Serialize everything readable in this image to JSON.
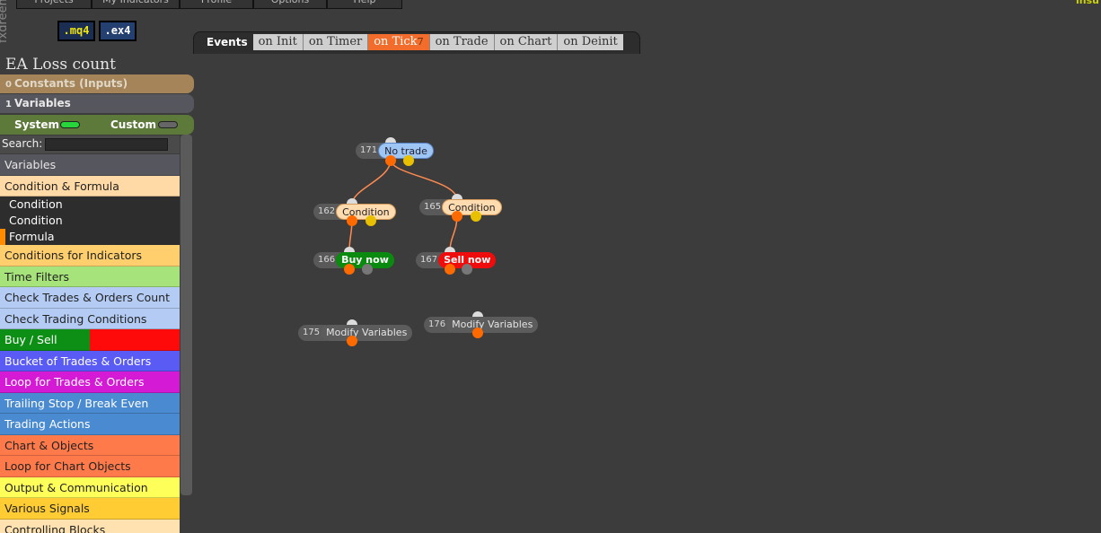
{
  "menu": [
    "Projects",
    "My Indicators",
    "Profile",
    "Options",
    "Help"
  ],
  "brand_vertical": "fxdreema",
  "corner_logo": "insu",
  "file_buttons": {
    "mq4": ".mq4",
    "ex4": ".ex4"
  },
  "events": {
    "label": "Events",
    "tabs": [
      {
        "label": "on Init"
      },
      {
        "label": "on Timer"
      },
      {
        "label": "on Tick",
        "count": "7",
        "active": true
      },
      {
        "label": "on Trade"
      },
      {
        "label": "on Chart"
      },
      {
        "label": "on Deinit"
      }
    ]
  },
  "sidebar": {
    "project_title": "EA Loss count",
    "constants": {
      "count": "0",
      "label": "Constants (Inputs)"
    },
    "variables": {
      "count": "1",
      "label": "Variables"
    },
    "system_label": "System",
    "custom_label": "Custom",
    "search_label": "Search:",
    "search_value": "",
    "categories": [
      "Variables",
      "Condition & Formula",
      "Conditions for Indicators",
      "Time Filters",
      "Check Trades & Orders Count",
      "Check Trading Conditions",
      "Buy / Sell",
      "Bucket of Trades & Orders",
      "Loop for Trades & Orders",
      "Trailing Stop / Break Even",
      "Trading Actions",
      "Chart & Objects",
      "Loop for Chart Objects",
      "Output & Communication",
      "Various Signals",
      "Controlling Blocks"
    ],
    "subitems": [
      "Condition",
      "Condition",
      "Formula"
    ]
  },
  "blocks": [
    {
      "id": "171",
      "name": "No trade"
    },
    {
      "id": "162",
      "name": "Condition"
    },
    {
      "id": "165",
      "name": "Condition"
    },
    {
      "id": "166",
      "name": "Buy now"
    },
    {
      "id": "167",
      "name": "Sell now"
    },
    {
      "id": "175",
      "name": "Modify Variables"
    },
    {
      "id": "176",
      "name": "Modify Variables"
    }
  ],
  "colors": {
    "canvas": "#3c3c3c",
    "active_tab": "#f26d2c",
    "buy": "#0a8a0f",
    "sell": "#ee0c0c",
    "wire": "#ff8a50"
  }
}
